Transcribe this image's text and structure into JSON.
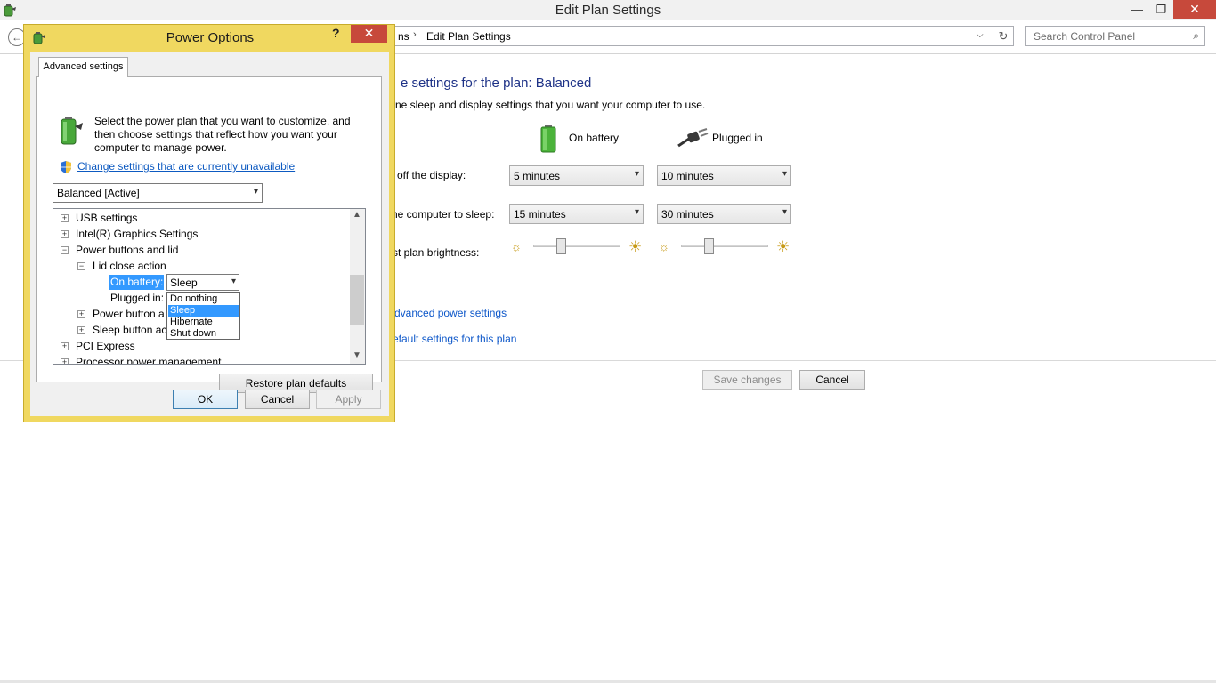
{
  "main_window": {
    "title": "Edit Plan Settings",
    "controls": {
      "minimize": "—",
      "maximize": "❐",
      "close": "✕"
    },
    "back_icon": "←",
    "breadcrumb": {
      "previous": "ns",
      "separator": "›",
      "current": "Edit Plan Settings"
    },
    "address_dropdown_icon": "⌵",
    "refresh_icon": "↻",
    "search": {
      "placeholder": "Search Control Panel",
      "icon": "⌕"
    },
    "heading": "e settings for the plan: Balanced",
    "description": "ne sleep and display settings that you want your computer to use.",
    "columns": {
      "battery": "On battery",
      "plugged": "Plugged in"
    },
    "rows": {
      "display_label": "off the display:",
      "sleep_label": "ne computer to sleep:",
      "brightness_label": "st plan brightness:"
    },
    "display": {
      "battery": "5 minutes",
      "plugged": "10 minutes"
    },
    "sleep": {
      "battery": "15 minutes",
      "plugged": "30 minutes"
    },
    "brightness": {
      "battery_level": 0.32,
      "plugged_level": 0.32
    },
    "sun_dim_icon": "☼",
    "sun_bright_icon": "☀",
    "links": {
      "advanced": "dvanced power settings",
      "restore": "efault settings for this plan"
    },
    "buttons": {
      "save": "Save changes",
      "cancel": "Cancel"
    }
  },
  "dialog": {
    "title": "Power Options",
    "help_icon": "?",
    "close_icon": "✕",
    "tab": "Advanced settings",
    "intro": "Select the power plan that you want to customize, and then choose settings that reflect how you want your computer to manage power.",
    "change_link": "Change settings that are currently unavailable",
    "plan_select": "Balanced [Active]",
    "tree": [
      {
        "label": "USB settings",
        "expander": "+"
      },
      {
        "label": "Intel(R) Graphics Settings",
        "expander": "+"
      },
      {
        "label": "Power buttons and lid",
        "expander": "−"
      },
      {
        "label": "Lid close action",
        "expander": "−"
      },
      {
        "label": "On battery:",
        "expander": ""
      },
      {
        "label": "Plugged in:",
        "expander": ""
      },
      {
        "label": "Power button a",
        "expander": "+"
      },
      {
        "label": "Sleep button ac",
        "expander": "+"
      },
      {
        "label": "PCI Express",
        "expander": "+"
      },
      {
        "label": "Processor power management",
        "expander": "+"
      }
    ],
    "lid_select_value": "Sleep",
    "lid_options": [
      "Do nothing",
      "Sleep",
      "Hibernate",
      "Shut down"
    ],
    "lid_selected_option": "Sleep",
    "scroll_up_icon": "▲",
    "scroll_down_icon": "▼",
    "dropdown_icon": "▾",
    "buttons": {
      "restore": "Restore plan defaults",
      "ok": "OK",
      "cancel": "Cancel",
      "apply": "Apply"
    }
  },
  "colors": {
    "dialog_frame": "#f0d860",
    "close_red": "#c7493b",
    "link_blue": "#0d57c9",
    "heading_blue": "#1e3287",
    "selection_blue": "#3399ff"
  }
}
